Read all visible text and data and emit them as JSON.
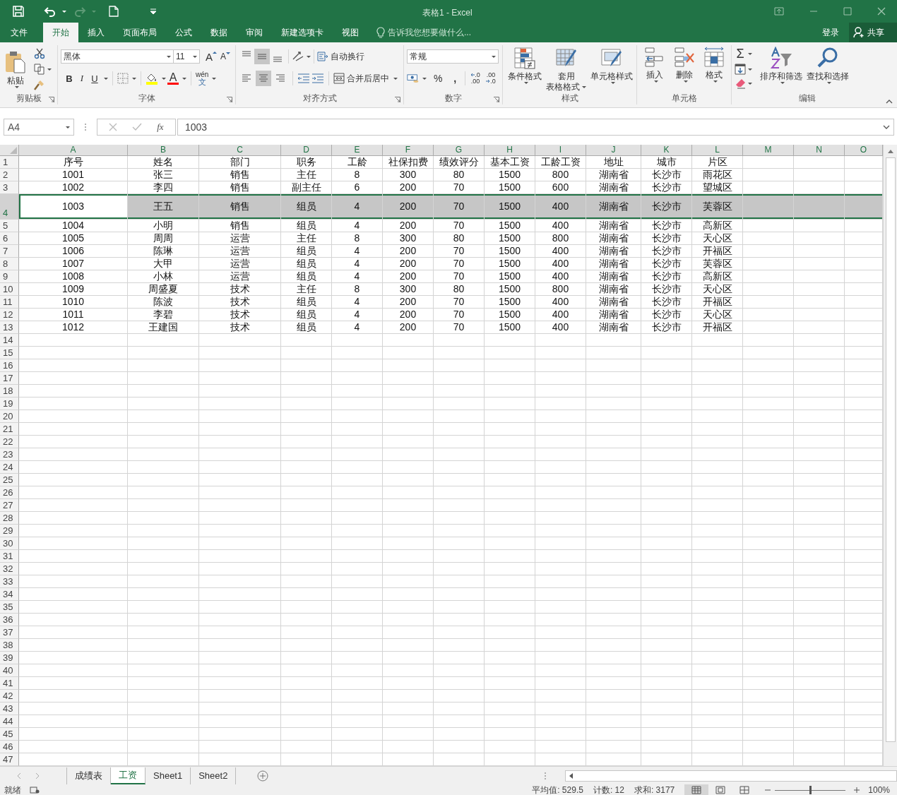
{
  "window": {
    "title": "表格1 - Excel"
  },
  "ribbon_tabs": [
    {
      "label": "文件",
      "selected": false
    },
    {
      "label": "开始",
      "selected": true
    },
    {
      "label": "插入",
      "selected": false
    },
    {
      "label": "页面布局",
      "selected": false
    },
    {
      "label": "公式",
      "selected": false
    },
    {
      "label": "数据",
      "selected": false
    },
    {
      "label": "审阅",
      "selected": false
    },
    {
      "label": "新建选项卡",
      "selected": false
    },
    {
      "label": "视图",
      "selected": false
    }
  ],
  "tell_me": {
    "placeholder": "告诉我您想要做什么..."
  },
  "account": {
    "sign_in": "登录",
    "share": "共享"
  },
  "clipboard": {
    "paste": "粘贴",
    "label": "剪贴板"
  },
  "font": {
    "name": "黑体",
    "size": "11",
    "grow": "A",
    "shrink": "A",
    "bold": "B",
    "italic": "I",
    "underline": "U",
    "font_color": "A",
    "phonetic_top": "wén",
    "phonetic_bottom": "文",
    "label": "字体"
  },
  "alignment": {
    "vertical_buttons": [
      {
        "selected": false
      },
      {
        "selected": true
      },
      {
        "selected": false
      }
    ],
    "horizontal_buttons": [
      {
        "selected": false
      },
      {
        "selected": true
      },
      {
        "selected": false
      }
    ],
    "wrap_text": "自动换行",
    "merge_center": "合并后居中",
    "label": "对齐方式"
  },
  "number": {
    "format": "常规",
    "percent": "%",
    "comma": ",",
    "increase_decimal": {
      "top": ".0",
      "bottom": ".00"
    },
    "decrease_decimal": {
      "top": ".00",
      "bottom": ".0"
    },
    "label": "数字"
  },
  "styles": {
    "buttons": [
      {
        "kind": "conditional",
        "lines": [
          "条件格式"
        ]
      },
      {
        "kind": "table",
        "lines": [
          "套用",
          "表格格式"
        ]
      },
      {
        "kind": "cell",
        "lines": [
          "单元格样式"
        ]
      }
    ],
    "label": "样式"
  },
  "cells": {
    "buttons": [
      {
        "kind": "insert",
        "label": "插入"
      },
      {
        "kind": "delete",
        "label": "删除"
      },
      {
        "kind": "format",
        "label": "格式"
      }
    ],
    "label": "单元格"
  },
  "editing": {
    "autosum": "Σ",
    "sort_filter": "排序和筛选",
    "find_select": "查找和选择",
    "label": "编辑"
  },
  "formula_bar": {
    "name_box": "A4",
    "function_label": "fx",
    "value": "1003"
  },
  "sheet": {
    "columns": [
      "A",
      "B",
      "C",
      "D",
      "E",
      "F",
      "G",
      "H",
      "I",
      "J",
      "K",
      "L",
      "M",
      "N",
      "O"
    ],
    "rows": [
      {
        "number": "1",
        "selected": false,
        "tall": false,
        "cells": [
          "序号",
          "姓名",
          "部门",
          "职务",
          "工龄",
          "社保扣费",
          "绩效评分",
          "基本工资",
          "工龄工资",
          "地址",
          "城市",
          "片区"
        ]
      },
      {
        "number": "2",
        "selected": false,
        "tall": false,
        "cells": [
          "1001",
          "张三",
          "销售",
          "主任",
          "8",
          "300",
          "80",
          "1500",
          "800",
          "湖南省",
          "长沙市",
          "雨花区"
        ]
      },
      {
        "number": "3",
        "selected": false,
        "tall": false,
        "cells": [
          "1002",
          "李四",
          "销售",
          "副主任",
          "6",
          "200",
          "70",
          "1500",
          "600",
          "湖南省",
          "长沙市",
          "望城区"
        ]
      },
      {
        "number": "4",
        "selected": true,
        "tall": true,
        "cells": [
          "1003",
          "王五",
          "销售",
          "组员",
          "4",
          "200",
          "70",
          "1500",
          "400",
          "湖南省",
          "长沙市",
          "芙蓉区"
        ]
      },
      {
        "number": "5",
        "selected": false,
        "tall": false,
        "cells": [
          "1004",
          "小明",
          "销售",
          "组员",
          "4",
          "200",
          "70",
          "1500",
          "400",
          "湖南省",
          "长沙市",
          "高新区"
        ]
      },
      {
        "number": "6",
        "selected": false,
        "tall": false,
        "cells": [
          "1005",
          "周周",
          "运营",
          "主任",
          "8",
          "300",
          "80",
          "1500",
          "800",
          "湖南省",
          "长沙市",
          "天心区"
        ]
      },
      {
        "number": "7",
        "selected": false,
        "tall": false,
        "cells": [
          "1006",
          "陈琳",
          "运营",
          "组员",
          "4",
          "200",
          "70",
          "1500",
          "400",
          "湖南省",
          "长沙市",
          "开福区"
        ]
      },
      {
        "number": "8",
        "selected": false,
        "tall": false,
        "cells": [
          "1007",
          "大甲",
          "运营",
          "组员",
          "4",
          "200",
          "70",
          "1500",
          "400",
          "湖南省",
          "长沙市",
          "芙蓉区"
        ]
      },
      {
        "number": "9",
        "selected": false,
        "tall": false,
        "cells": [
          "1008",
          "小林",
          "运营",
          "组员",
          "4",
          "200",
          "70",
          "1500",
          "400",
          "湖南省",
          "长沙市",
          "高新区"
        ]
      },
      {
        "number": "10",
        "selected": false,
        "tall": false,
        "cells": [
          "1009",
          "周盛夏",
          "技术",
          "主任",
          "8",
          "300",
          "80",
          "1500",
          "800",
          "湖南省",
          "长沙市",
          "天心区"
        ]
      },
      {
        "number": "11",
        "selected": false,
        "tall": false,
        "cells": [
          "1010",
          "陈波",
          "技术",
          "组员",
          "4",
          "200",
          "70",
          "1500",
          "400",
          "湖南省",
          "长沙市",
          "开福区"
        ]
      },
      {
        "number": "12",
        "selected": false,
        "tall": false,
        "cells": [
          "1011",
          "李碧",
          "技术",
          "组员",
          "4",
          "200",
          "70",
          "1500",
          "400",
          "湖南省",
          "长沙市",
          "天心区"
        ]
      },
      {
        "number": "13",
        "selected": false,
        "tall": false,
        "cells": [
          "1012",
          "王建国",
          "技术",
          "组员",
          "4",
          "200",
          "70",
          "1500",
          "400",
          "湖南省",
          "长沙市",
          "开福区"
        ]
      },
      {
        "number": "14",
        "selected": false,
        "tall": false,
        "cells": []
      },
      {
        "number": "15",
        "selected": false,
        "tall": false,
        "cells": []
      },
      {
        "number": "16",
        "selected": false,
        "tall": false,
        "cells": []
      },
      {
        "number": "17",
        "selected": false,
        "tall": false,
        "cells": []
      },
      {
        "number": "18",
        "selected": false,
        "tall": false,
        "cells": []
      },
      {
        "number": "19",
        "selected": false,
        "tall": false,
        "cells": []
      },
      {
        "number": "20",
        "selected": false,
        "tall": false,
        "cells": []
      },
      {
        "number": "21",
        "selected": false,
        "tall": false,
        "cells": []
      },
      {
        "number": "22",
        "selected": false,
        "tall": false,
        "cells": []
      },
      {
        "number": "23",
        "selected": false,
        "tall": false,
        "cells": []
      },
      {
        "number": "24",
        "selected": false,
        "tall": false,
        "cells": []
      },
      {
        "number": "25",
        "selected": false,
        "tall": false,
        "cells": []
      },
      {
        "number": "26",
        "selected": false,
        "tall": false,
        "cells": []
      },
      {
        "number": "27",
        "selected": false,
        "tall": false,
        "cells": []
      },
      {
        "number": "28",
        "selected": false,
        "tall": false,
        "cells": []
      },
      {
        "number": "29",
        "selected": false,
        "tall": false,
        "cells": []
      },
      {
        "number": "30",
        "selected": false,
        "tall": false,
        "cells": []
      },
      {
        "number": "31",
        "selected": false,
        "tall": false,
        "cells": []
      },
      {
        "number": "32",
        "selected": false,
        "tall": false,
        "cells": []
      },
      {
        "number": "33",
        "selected": false,
        "tall": false,
        "cells": []
      },
      {
        "number": "34",
        "selected": false,
        "tall": false,
        "cells": []
      },
      {
        "number": "35",
        "selected": false,
        "tall": false,
        "cells": []
      },
      {
        "number": "36",
        "selected": false,
        "tall": false,
        "cells": []
      },
      {
        "number": "37",
        "selected": false,
        "tall": false,
        "cells": []
      },
      {
        "number": "38",
        "selected": false,
        "tall": false,
        "cells": []
      },
      {
        "number": "39",
        "selected": false,
        "tall": false,
        "cells": []
      },
      {
        "number": "40",
        "selected": false,
        "tall": false,
        "cells": []
      },
      {
        "number": "41",
        "selected": false,
        "tall": false,
        "cells": []
      },
      {
        "number": "42",
        "selected": false,
        "tall": false,
        "cells": []
      },
      {
        "number": "43",
        "selected": false,
        "tall": false,
        "cells": []
      },
      {
        "number": "44",
        "selected": false,
        "tall": false,
        "cells": []
      },
      {
        "number": "45",
        "selected": false,
        "tall": false,
        "cells": []
      },
      {
        "number": "46",
        "selected": false,
        "tall": false,
        "cells": []
      },
      {
        "number": "47",
        "selected": false,
        "tall": false,
        "cells": []
      }
    ]
  },
  "sheet_tabs": [
    {
      "label": "成绩表",
      "selected": false
    },
    {
      "label": "工资",
      "selected": true
    },
    {
      "label": "Sheet1",
      "selected": false
    },
    {
      "label": "Sheet2",
      "selected": false
    }
  ],
  "status_bar": {
    "ready": "就绪",
    "average": "平均值: 529.5",
    "count": "计数: 12",
    "sum": "求和: 3177",
    "views": [
      {
        "selected": true
      },
      {
        "selected": false
      },
      {
        "selected": false
      }
    ],
    "zoom": {
      "level": 0.5
    },
    "zoom_text": "100%"
  }
}
